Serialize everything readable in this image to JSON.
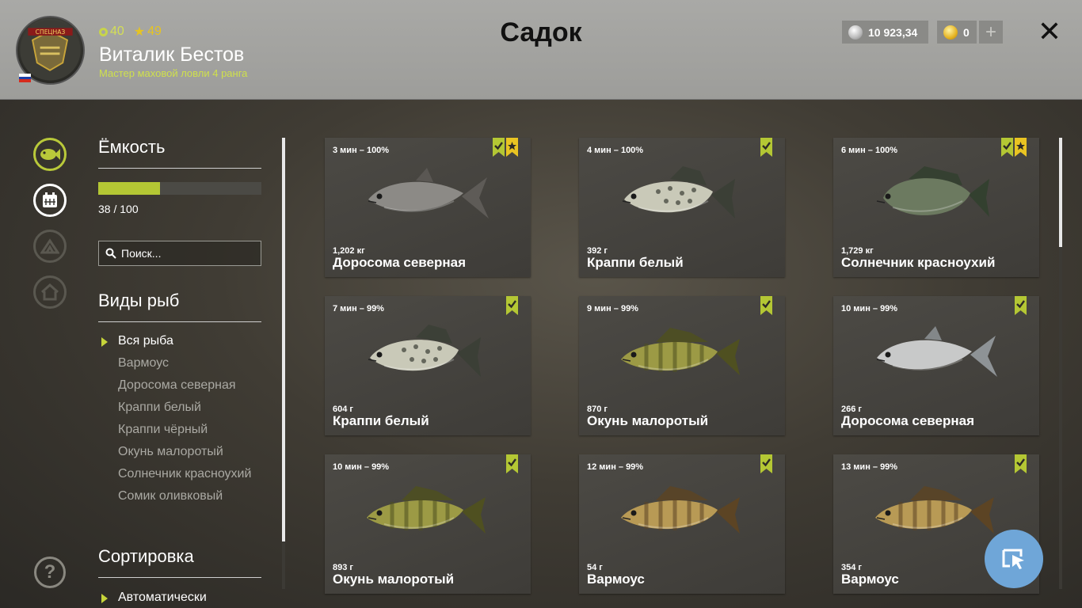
{
  "header": {
    "level": "40",
    "rank": "49",
    "player_name": "Виталик Бестов",
    "player_title": "Мастер маховой ловли 4 ранга",
    "page_title": "Садок",
    "silver": "10 923,34",
    "gold": "0",
    "plus_label": "+",
    "close_label": "✕",
    "avatar_text": "СПЕЦНАЗ"
  },
  "capacity": {
    "title": "Ёмкость",
    "fill_fraction": 0.38,
    "text": "38 / 100"
  },
  "search": {
    "placeholder": "Поиск..."
  },
  "species": {
    "title": "Виды рыб",
    "items": [
      {
        "label": "Вся рыба",
        "active": true
      },
      {
        "label": "Вармоус",
        "active": false
      },
      {
        "label": "Доросома северная",
        "active": false
      },
      {
        "label": "Краппи белый",
        "active": false
      },
      {
        "label": "Краппи чёрный",
        "active": false
      },
      {
        "label": "Окунь малоротый",
        "active": false
      },
      {
        "label": "Солнечник красноухий",
        "active": false
      },
      {
        "label": "Сомик оливковый",
        "active": false
      }
    ]
  },
  "sort": {
    "title": "Сортировка",
    "selected": "Автоматически"
  },
  "help_label": "?",
  "fish": [
    {
      "meta": "3 мин – 100%",
      "weight": "1,202 кг",
      "name": "Доросома северная",
      "star": true,
      "kind": "shad"
    },
    {
      "meta": "4 мин – 100%",
      "weight": "392 г",
      "name": "Краппи белый",
      "star": false,
      "kind": "crappie"
    },
    {
      "meta": "6 мин – 100%",
      "weight": "1,729 кг",
      "name": "Солнечник красноухий",
      "star": true,
      "kind": "sunfish"
    },
    {
      "meta": "7 мин – 99%",
      "weight": "604 г",
      "name": "Краппи белый",
      "star": false,
      "kind": "crappie"
    },
    {
      "meta": "9 мин – 99%",
      "weight": "870 г",
      "name": "Окунь малоротый",
      "star": false,
      "kind": "bass"
    },
    {
      "meta": "10 мин – 99%",
      "weight": "266 г",
      "name": "Доросома северная",
      "star": false,
      "kind": "shad2"
    },
    {
      "meta": "10 мин – 99%",
      "weight": "893 г",
      "name": "Окунь малоротый",
      "star": false,
      "kind": "bass"
    },
    {
      "meta": "12 мин – 99%",
      "weight": "54 г",
      "name": "Вармоус",
      "star": false,
      "kind": "warmouth"
    },
    {
      "meta": "13 мин – 99%",
      "weight": "354 г",
      "name": "Вармоус",
      "star": false,
      "kind": "warmouth"
    }
  ],
  "colors": {
    "accent": "#b4c734",
    "fish": {
      "shad": [
        "#8c8a86",
        "#5e5b57"
      ],
      "shad2": [
        "#c8c9c9",
        "#8e9396"
      ],
      "crappie": [
        "#c9c9b8",
        "#3b3f36"
      ],
      "sunfish": [
        "#6c7a60",
        "#33402f"
      ],
      "bass": [
        "#9c9a45",
        "#4f5020"
      ],
      "warmouth": [
        "#b89a55",
        "#5c4424"
      ]
    }
  }
}
